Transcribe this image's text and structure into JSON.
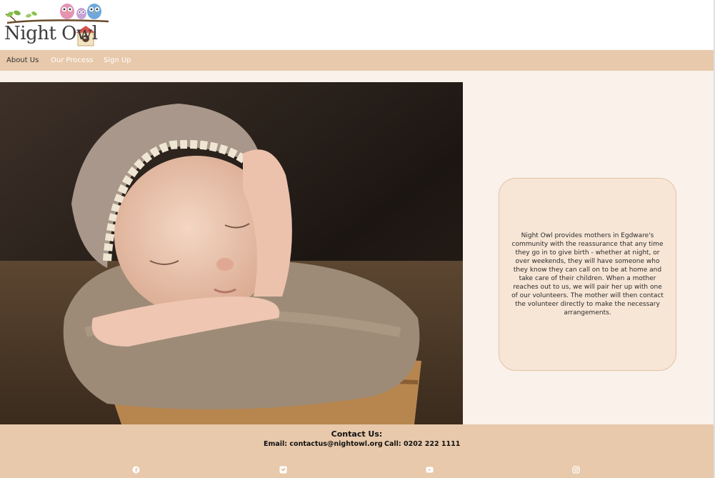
{
  "logo": {
    "text": "Night Owl"
  },
  "nav": {
    "items": [
      {
        "label": "About Us"
      },
      {
        "label": "Our Process"
      },
      {
        "label": "Sign Up"
      }
    ]
  },
  "about": {
    "text": "Night Owl provides mothers in Egdware's community with the reassurance that any time they go in to give birth - whether at night, or over weekends, they will have someone who they know they can call on to be at home and take care of their children. When a mother reaches out to us, we will pair her up with one of our volunteers. The mother will then contact the volunteer directly to make the necessary arrangements."
  },
  "footer": {
    "title": "Contact Us:",
    "email": "Email: contactus@nightowl.org",
    "phone": "Call: 0202 222 1111",
    "social": [
      "facebook-icon",
      "twitter-icon",
      "youtube-icon",
      "instagram-icon"
    ]
  },
  "colors": {
    "nav_bg": "#e8c9ab",
    "main_bg": "#f9f1ea",
    "card_bg": "#f7e6d6",
    "footer_bg": "#e8c9ab"
  }
}
